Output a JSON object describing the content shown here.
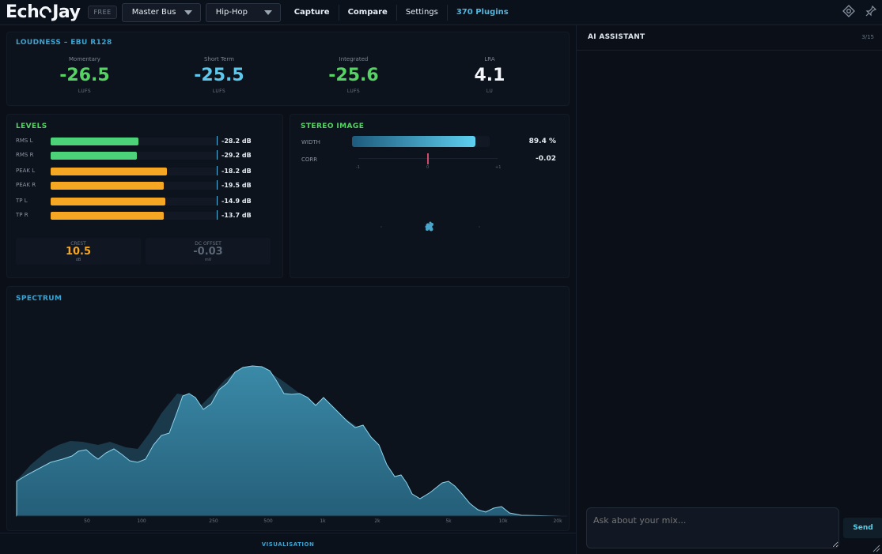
{
  "app": {
    "logo_left": "Ech",
    "logo_right": "Jay",
    "badge": "FREE"
  },
  "toolbar": {
    "bus_select": "Master Bus",
    "genre_select": "Hip-Hop",
    "nav": [
      "Capture",
      "Compare",
      "Settings",
      "370 Plugins"
    ]
  },
  "loudness": {
    "title": "LOUDNESS – EBU R128",
    "metrics": [
      {
        "label": "Momentary",
        "value": "-26.5",
        "unit": "LUFS",
        "color": "#56d364"
      },
      {
        "label": "Short Term",
        "value": "-25.5",
        "unit": "LUFS",
        "color": "#5ec8ec"
      },
      {
        "label": "Integrated",
        "value": "-25.6",
        "unit": "LUFS",
        "color": "#56d364"
      },
      {
        "label": "LRA",
        "value": "4.1",
        "unit": "LU",
        "color": "#f3f6fa"
      }
    ]
  },
  "levels": {
    "title": "LEVELS",
    "rows": [
      {
        "name": "RMS L",
        "value": "-28.2 dB",
        "fill": 0.53,
        "color": "#4cd37a"
      },
      {
        "name": "RMS R",
        "value": "-29.2 dB",
        "fill": 0.52,
        "color": "#4cd37a"
      },
      {
        "name": "PEAK L",
        "value": "-18.2 dB",
        "fill": 0.7,
        "color": "#f5a623"
      },
      {
        "name": "PEAK R",
        "value": "-19.5 dB",
        "fill": 0.68,
        "color": "#f5a623"
      },
      {
        "name": "TP L",
        "value": "-14.9 dB",
        "fill": 0.69,
        "color": "#f5a623"
      },
      {
        "name": "TP R",
        "value": "-13.7 dB",
        "fill": 0.68,
        "color": "#f5a623"
      }
    ],
    "crest": {
      "label": "CREST",
      "value": "10.5",
      "unit": "dB"
    },
    "dc_offset": {
      "label": "DC OFFSET",
      "value": "-0.03",
      "unit": "mV"
    }
  },
  "stereo": {
    "title": "STEREO IMAGE",
    "width_label": "WIDTH",
    "width_value": "89.4 %",
    "width_fraction": 0.894,
    "corr_label": "CORR",
    "corr_value": "-0.02",
    "corr_ticks": [
      "-1",
      "0",
      "+1"
    ]
  },
  "spectrum": {
    "title": "SPECTRUM",
    "x_ticks": [
      "50",
      "100",
      "250",
      "500",
      "1k",
      "2k",
      "5k",
      "10k",
      "20k"
    ]
  },
  "bottom": {
    "label": "VISUALISATION"
  },
  "ai": {
    "title": "AI ASSISTANT",
    "count": "3/15",
    "placeholder": "Ask about your mix...",
    "send": "Send"
  },
  "colors": {
    "accent": "#3ea2cf",
    "green": "#56d364",
    "orange": "#f5a623",
    "spectrum_fill": "#2f7d99"
  },
  "icons": [
    "target-icon",
    "pin-icon"
  ]
}
